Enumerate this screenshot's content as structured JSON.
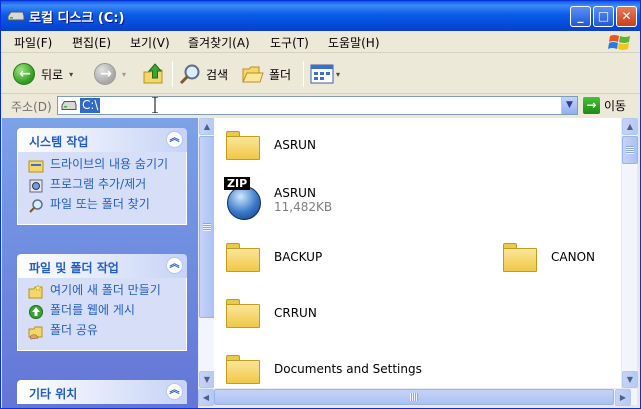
{
  "window": {
    "title": "로컬 디스크 (C:)",
    "minimize_glyph": "_",
    "maximize_glyph": "□",
    "close_glyph": "✕"
  },
  "menu": [
    "파일(F)",
    "편집(E)",
    "보기(V)",
    "즐겨찾기(A)",
    "도구(T)",
    "도움말(H)"
  ],
  "toolbar": {
    "back_label": "뒤로",
    "search_label": "검색",
    "folders_label": "폴더"
  },
  "address": {
    "label": "주소(D)",
    "value": "C:\\",
    "go_label": "이동"
  },
  "left_pane": {
    "panels": [
      {
        "title": "시스템 작업",
        "tasks": [
          {
            "label": "드라이브의 내용 숨기기",
            "icon": "hide-contents-icon"
          },
          {
            "label": "프로그램 추가/제거",
            "icon": "add-remove-programs-icon"
          },
          {
            "label": "파일 또는 폴더 찾기",
            "icon": "search-icon"
          }
        ]
      },
      {
        "title": "파일 및 폴더 작업",
        "tasks": [
          {
            "label": "여기에 새 폴더 만들기",
            "icon": "new-folder-icon"
          },
          {
            "label": "폴더를 웹에 게시",
            "icon": "publish-web-icon"
          },
          {
            "label": "폴더 공유",
            "icon": "share-folder-icon"
          }
        ]
      },
      {
        "title": "기타 위치",
        "tasks": []
      }
    ]
  },
  "files": [
    {
      "name": "ASRUN",
      "type": "folder"
    },
    {
      "name": "ASRUN",
      "type": "zip",
      "size": "11,482KB",
      "badge": "ZIP"
    },
    {
      "name": "BACKUP",
      "type": "folder"
    },
    {
      "name": "CANON",
      "type": "folder"
    },
    {
      "name": "CRRUN",
      "type": "folder"
    },
    {
      "name": "Documents and Settings",
      "type": "folder"
    }
  ],
  "colors": {
    "title_bar": "#0a5ce6",
    "task_pane": "#6375d6",
    "link_text": "#215dc6"
  }
}
